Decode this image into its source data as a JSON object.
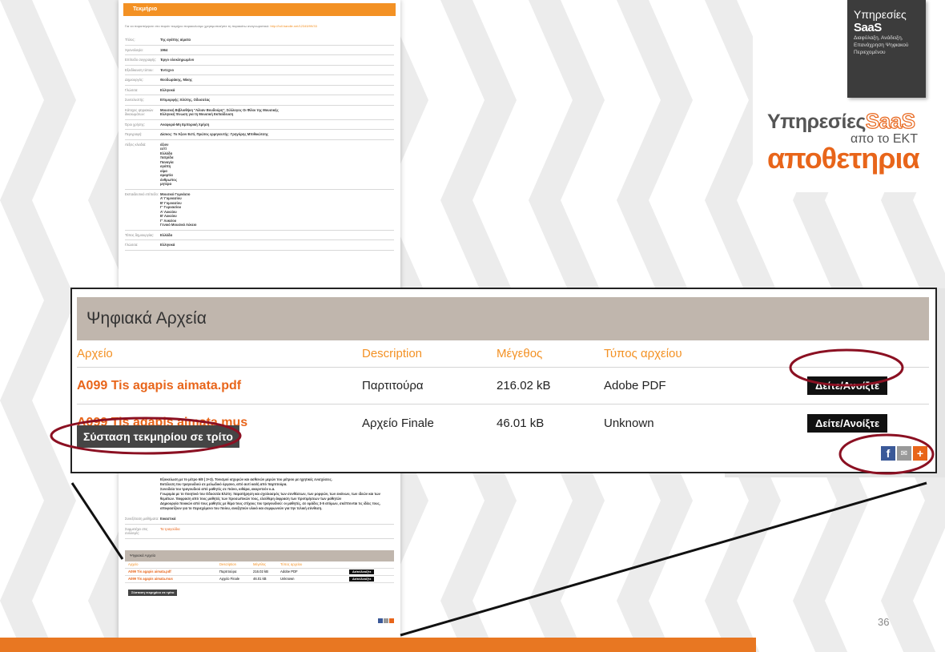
{
  "scan": {
    "header": "Τεκμήριο",
    "intro": "Για να παραπέμψετε στο παρόν τεκμήριο παρακαλούμε χρησιμοποιήστε τη παρακάτω αναγνωριστικό:",
    "intro_link": "http://hdl.handle.net/12345/99/33",
    "rows": [
      {
        "k": "Τίτλος:",
        "v": "Της αγάπης αίματα"
      },
      {
        "k": "Χρονολογία:",
        "v": "1964"
      },
      {
        "k": "Επίπεδο συγγραφής:",
        "v": "Έργο ολοκληρωμένο"
      },
      {
        "k": "Εξειδίκευση τύπου:",
        "v": "Έντεχνο"
      },
      {
        "k": "Δημιουργός:",
        "v": "Θεοδωράκης, Μίκης"
      },
      {
        "k": "Γλώσσα:",
        "v": "Ελληνικά"
      },
      {
        "k": "Συντελεστής:",
        "v": "Επιμορφής: Ελύτης, Οδυσσέας"
      },
      {
        "k": "Κάτοχος ψηφιακών δικαιωμάτων:",
        "v": "Μουσική Βιβλιοθήκη \"Λίλιαν Βουδούρη\", Σύλλογος Οι Φίλοι της Μουσικής\nΕλληνική Ένωση για τη Μουσική Εκπαίδευση"
      },
      {
        "k": "Όροι χρήσης:",
        "v": "Αναφορά-Μη Εμπορική Χρήση"
      },
      {
        "k": "Περιγραφή:",
        "v": "Δίσκος: Το Άξιον Εστί, Πρώτος ερμηνευτής: Γρηγόρης Μπιθικώτσης"
      },
      {
        "k": "Λέξεις κλειδιά:",
        "v": "άξιον\nεστί\nΕλλάδα\nπατρίδα\nΠαναγία\nαγάπη\nαίμα\nαμαρτία\nάνθρωπος\nμητέρα"
      },
      {
        "k": "Εκπαιδευτικό επίπεδο:",
        "v": "Μουσικό Γυμνάσιο\nΑ' Γυμνασίου\nΒ' Γυμνασίου\nΓ' Γυμνασίου\nΑ' Λυκείου\nΒ' Λυκείου\nΓ' Λυκείου\nΓενικό Μουσικό Λύκειο"
      },
      {
        "k": "Τόπος δημιουργίας:",
        "v": "Ελλάδα"
      },
      {
        "k": "Γλώσσα:",
        "v": "Ελληνικά"
      }
    ],
    "description": "Εξοικείωση με το μέτρο 6/8 ( 3+3). Τονισμοί ισχυρών και ασθενών μερών του μέτρου με ηχητικές ενισχύσεις.\nΕκτέλεση του τραγουδιού σε μελωδικό όργανο, από αυτί και/ή από παρτιτούρα.\nΣυνοδεία του τραγουδιού από μαθητές σε πιάνο, κιθάρα, ακορντεόν κ.α.\nΓνωριμία με το ποιητικό του Οδυσσέα Ελύτη: παρατήρηση και σχολιασμός των συνθέσεων, των μορφών, των εικόνων, των ιδεών και των θεμάτων. Έκφραση από τους μαθητές των προσωπικών τους, ελεύθερη έκφραση των προτιμήσεων των μαθητών\nΔημιουργία ποιικών από τους μαθητές με θέμα τους στίχους του τραγουδιού: οι μαθητές, σε ομάδες 3-5 ατόμων, σκέπτονται τις ιδέες τους, αποφασίζουν για το περιεχόμενο του ποίου, αναζητούν υλικό και συμφωνούν για την τελική σύνθεση.",
    "lower_rows": [
      {
        "k": "Συνεξέταση μαθήματα:",
        "v": "Εικαστικά",
        "orange": false
      },
      {
        "k": "Συμμετέχει στις συλλογές:",
        "v": "Τα τραγούδια",
        "orange": true
      }
    ]
  },
  "mini_panel": {
    "title": "Ψηφιακά Αρχεία",
    "headers": [
      "Αρχείο",
      "Description",
      "Μέγεθος",
      "Τύπος αρχείου"
    ],
    "rows": [
      {
        "name": "A099 Tis agapis aimata.pdf",
        "desc": "Παρτιτούρα",
        "size": "216.02 kB",
        "type": "Adobe PDF",
        "btn": "Δείτε/Ανοίξτε"
      },
      {
        "name": "A099 Tis agapis aimata.mus",
        "desc": "Αρχείο Finale",
        "size": "46.01 kB",
        "type": "Unknown",
        "btn": "Δείτε/Ανοίξτε"
      }
    ],
    "recommend": "Σύσταση τεκμηρίου σε τρίτο"
  },
  "zoom_panel": {
    "title": "Ψηφιακά Αρχεία",
    "headers": [
      "Αρχείο",
      "Description",
      "Μέγεθος",
      "Τύπος αρχείου"
    ],
    "rows": [
      {
        "name": "A099 Tis agapis aimata.pdf",
        "desc": "Παρτιτούρα",
        "size": "216.02 kB",
        "type": "Adobe PDF",
        "btn": "Δείτε/Ανοίξτε"
      },
      {
        "name": "A099 Tis agapis aimata.mus",
        "desc": "Αρχείο Finale",
        "size": "46.01 kB",
        "type": "Unknown",
        "btn": "Δείτε/Ανοίξτε"
      }
    ],
    "recommend": "Σύσταση τεκμηρίου σε τρίτο",
    "social": [
      "facebook-icon",
      "share-icon",
      "plus-icon"
    ]
  },
  "badge": {
    "title": "Υπηρεσίες",
    "name": "SaaS",
    "subtitle": "Διαφύλαξη, Ανάδειξη, Επανάχρηση Ψηφιακού Περιεχομένου"
  },
  "brand": {
    "line1": "Υπηρεσίες",
    "saas": "SaaS",
    "line2": "απο το ΕΚΤ",
    "line3": "αποθετηρια"
  },
  "slide_number": "36",
  "colors": {
    "accent": "#e8651a",
    "header_orange": "#f39124",
    "panel_header": "#c0b6ad",
    "ellipse": "#8b1022",
    "bottom_bar": "#e87722"
  }
}
